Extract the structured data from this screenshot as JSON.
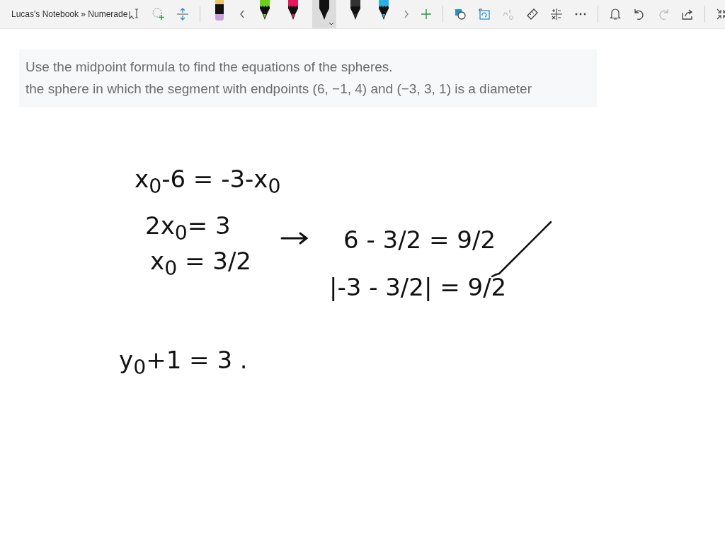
{
  "window": {
    "title": "Lucas's Notebook » Numerade"
  },
  "pens": [
    {
      "kind": "highlighter",
      "color": "#e9c46a",
      "selected": false
    },
    {
      "kind": "pen",
      "color": "#6ccf1c",
      "selected": false
    },
    {
      "kind": "pen",
      "color": "#e8175d",
      "selected": false
    },
    {
      "kind": "pen",
      "color": "#111111",
      "selected": true
    },
    {
      "kind": "pen",
      "color": "#333333",
      "selected": false
    },
    {
      "kind": "pen",
      "color": "#2ab0e6",
      "selected": false
    }
  ],
  "question": {
    "lines": [
      "Use the midpoint formula to find the equations of the spheres.",
      "the sphere in which the segment with endpoints (6, −1, 4) and (−3, 3, 1) is a diameter"
    ]
  },
  "ink": [
    {
      "kind": "text",
      "text": "x$_{0}$-6 = -3-x$_{0}$"
    },
    {
      "kind": "text",
      "text": "2x$_{0}$= 3"
    },
    {
      "kind": "text",
      "text": "x$_{0}$ = 3/2"
    },
    {
      "kind": "arrow"
    },
    {
      "kind": "text",
      "text": "6 - 3/2 = 9/2"
    },
    {
      "kind": "text",
      "text": "|-3 - 3/2| = 9/2"
    },
    {
      "kind": "check"
    },
    {
      "kind": "text",
      "text": "y$_{0}$+1 = 3 ."
    }
  ]
}
